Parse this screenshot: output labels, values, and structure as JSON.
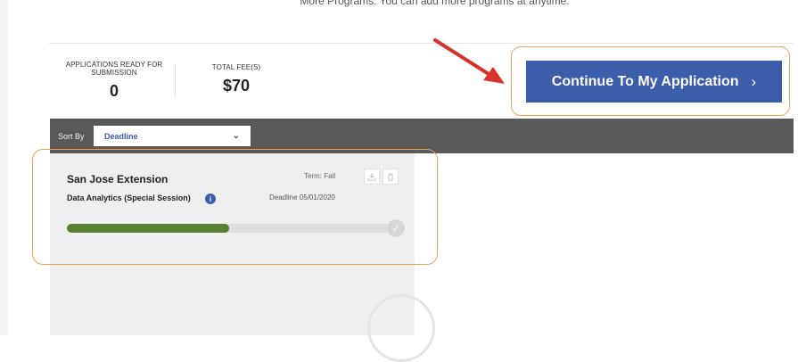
{
  "top_note": "More Programs. You can add more programs at anytime.",
  "summary": {
    "applications_label": "APPLICATIONS READY FOR SUBMISSION",
    "applications_value": "0",
    "fee_label": "TOTAL FEE(S)",
    "fee_value": "$70"
  },
  "actions": {
    "continue_label": "Continue To My Application",
    "continue_chevron": "›"
  },
  "sort": {
    "label": "Sort By",
    "selected": "Deadline"
  },
  "card": {
    "institution": "San Jose Extension",
    "term": "Term: Fall",
    "program": "Data Analytics (Special Session)",
    "deadline": "Deadline 05/01/2020",
    "progress": 0.49
  },
  "colors": {
    "accent": "#3c5da9",
    "progress": "#5a7f32",
    "sort_bar": "#595959",
    "highlight": "#e8a25a",
    "arrow": "#d8332b"
  },
  "icons": [
    "download-icon",
    "trash-icon",
    "info-icon",
    "check-icon",
    "chevron-down-icon",
    "chevron-right-icon"
  ]
}
